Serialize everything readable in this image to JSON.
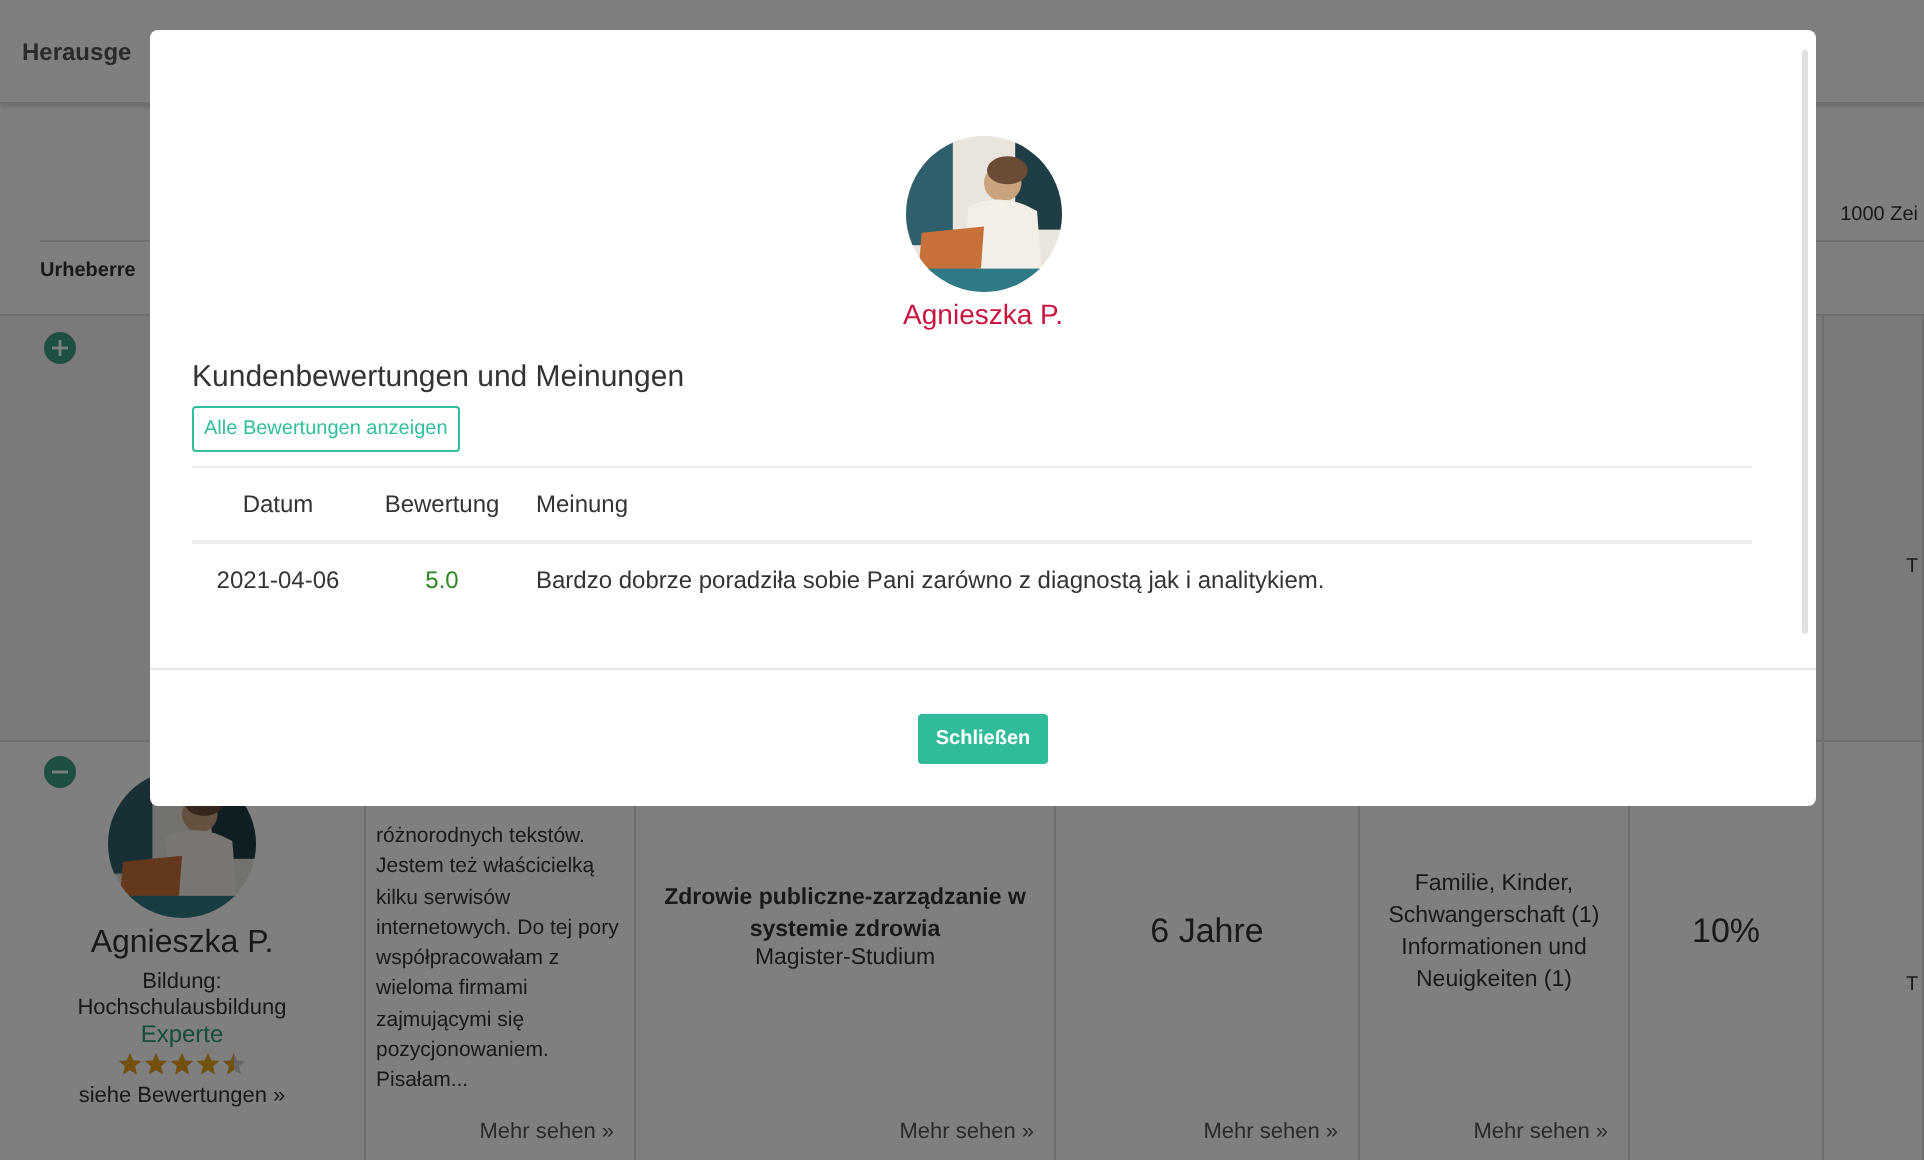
{
  "background": {
    "header_tab": "Herausge",
    "length_label": "1000 Zei",
    "column_1": "Urheberre"
  },
  "rows": [
    {
      "expanded": false,
      "column_7": "T"
    },
    {
      "expanded": true,
      "author": {
        "name": "Agnieszka P.",
        "education_label": "Bildung:",
        "education": "Hochschulausbildung",
        "level": "Experte",
        "stars": 4.5,
        "reviews_link": "siehe Bewertungen »"
      },
      "description": "różnorodnych tekstów. Jestem też właścicielką kilku serwisów internetowych. Do tej pory współpracowałam z wieloma firmami zajmującymi się pozycjonowaniem. Pisałam...",
      "description_more": "Mehr sehen »",
      "field": "Zdrowie publiczne-zarządzanie w systemie zdrowia",
      "degree": "Magister-Studium",
      "field_more": "Mehr sehen »",
      "experience": "6 Jahre",
      "experience_more": "Mehr sehen »",
      "topics": [
        "Familie, Kinder, Schwangerschaft (1)",
        "Informationen und Neuigkeiten (1)"
      ],
      "topics_more": "Mehr sehen »",
      "discount": "10%",
      "column_7": "T"
    }
  ],
  "modal": {
    "name": "Agnieszka P.",
    "heading": "Kundenbewertungen und Meinungen",
    "all_reviews_button": "Alle Bewertungen anzeigen",
    "columns": [
      "Datum",
      "Bewertung",
      "Meinung"
    ],
    "reviews": [
      {
        "date": "2021-04-06",
        "rating": "5.0",
        "opinion": "Bardzo dobrze poradziła sobie Pani zarówno z diagnostą jak i analitykiem."
      }
    ],
    "close_button": "Schließen"
  }
}
